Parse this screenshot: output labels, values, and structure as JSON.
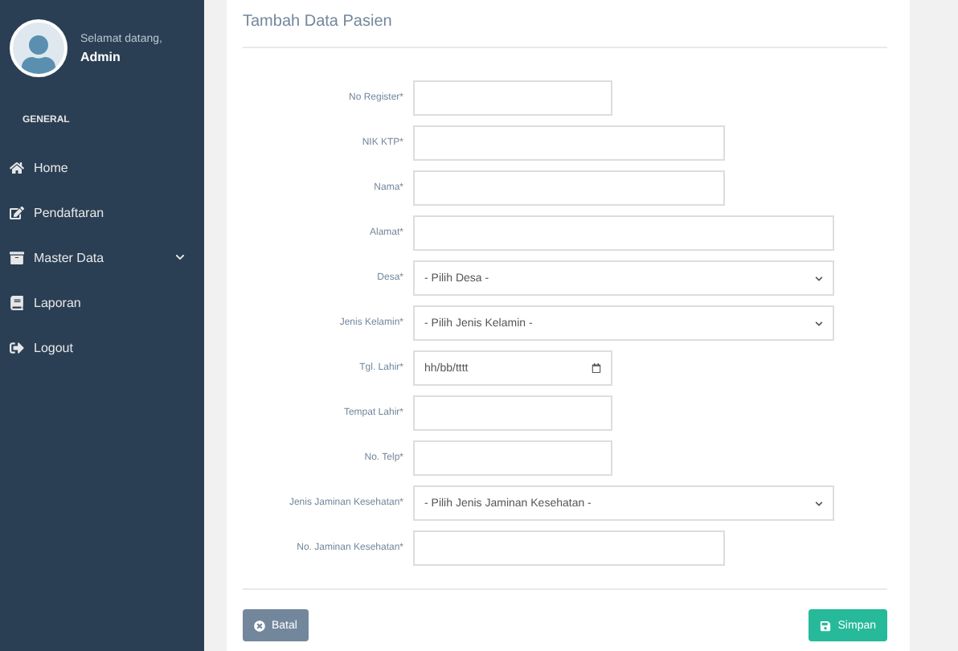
{
  "sidebar": {
    "greeting": "Selamat datang,",
    "user": "Admin",
    "section": "GENERAL",
    "items": [
      {
        "label": "Home",
        "kind": "link"
      },
      {
        "label": "Pendaftaran",
        "kind": "link"
      },
      {
        "label": "Master Data",
        "kind": "group"
      },
      {
        "label": "Laporan",
        "kind": "link"
      },
      {
        "label": "Logout",
        "kind": "link"
      }
    ]
  },
  "panel": {
    "title": "Tambah Data Pasien",
    "fields": [
      {
        "label": "No Register*",
        "kind": "text"
      },
      {
        "label": "NIK KTP*",
        "kind": "text"
      },
      {
        "label": "Nama*",
        "kind": "text"
      },
      {
        "label": "Alamat*",
        "kind": "text"
      },
      {
        "label": "Desa*",
        "kind": "select",
        "value": "- Pilih Desa -"
      },
      {
        "label": "Jenis Kelamin*",
        "kind": "select",
        "value": "- Pilih Jenis Kelamin -"
      },
      {
        "label": "Tgl. Lahir*",
        "kind": "date",
        "value": "hh/bb/tttt"
      },
      {
        "label": "Tempat Lahir*",
        "kind": "text"
      },
      {
        "label": "No. Telp*",
        "kind": "text"
      },
      {
        "label": "Jenis Jaminan Kesehatan*",
        "kind": "select",
        "value": "- Pilih Jenis Jaminan Kesehatan -"
      },
      {
        "label": "No. Jaminan Kesehatan*",
        "kind": "text"
      }
    ],
    "cancel": "Batal",
    "save": "Simpan"
  }
}
